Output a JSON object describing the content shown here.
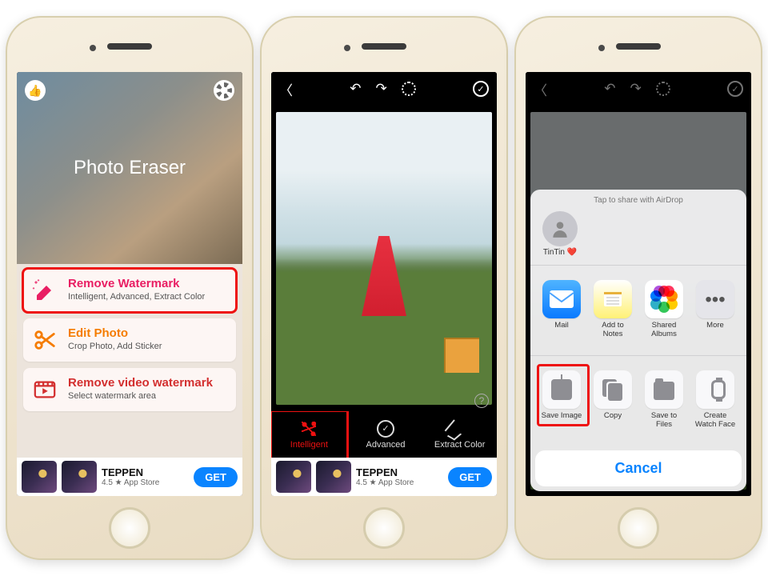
{
  "screen1": {
    "title": "Photo Eraser",
    "cards": [
      {
        "title": "Remove Watermark",
        "sub": "Intelligent, Advanced, Extract Color"
      },
      {
        "title": "Edit Photo",
        "sub": "Crop Photo, Add Sticker"
      },
      {
        "title": "Remove video watermark",
        "sub": "Select watermark area"
      }
    ]
  },
  "ad": {
    "name": "TEPPEN",
    "sub": "4.5 ★ App Store",
    "cta": "GET"
  },
  "screen2": {
    "tabs": [
      "Intelligent",
      "Advanced",
      "Extract Color"
    ],
    "help": "?"
  },
  "screen3": {
    "airdrop_hint": "Tap to share with AirDrop",
    "contact_name": "TinTin ❤️",
    "apps": [
      "Mail",
      "Add to Notes",
      "Shared Albums",
      "More"
    ],
    "actions": [
      "Save Image",
      "Copy",
      "Save to Files",
      "Create Watch Face"
    ],
    "cancel": "Cancel"
  }
}
